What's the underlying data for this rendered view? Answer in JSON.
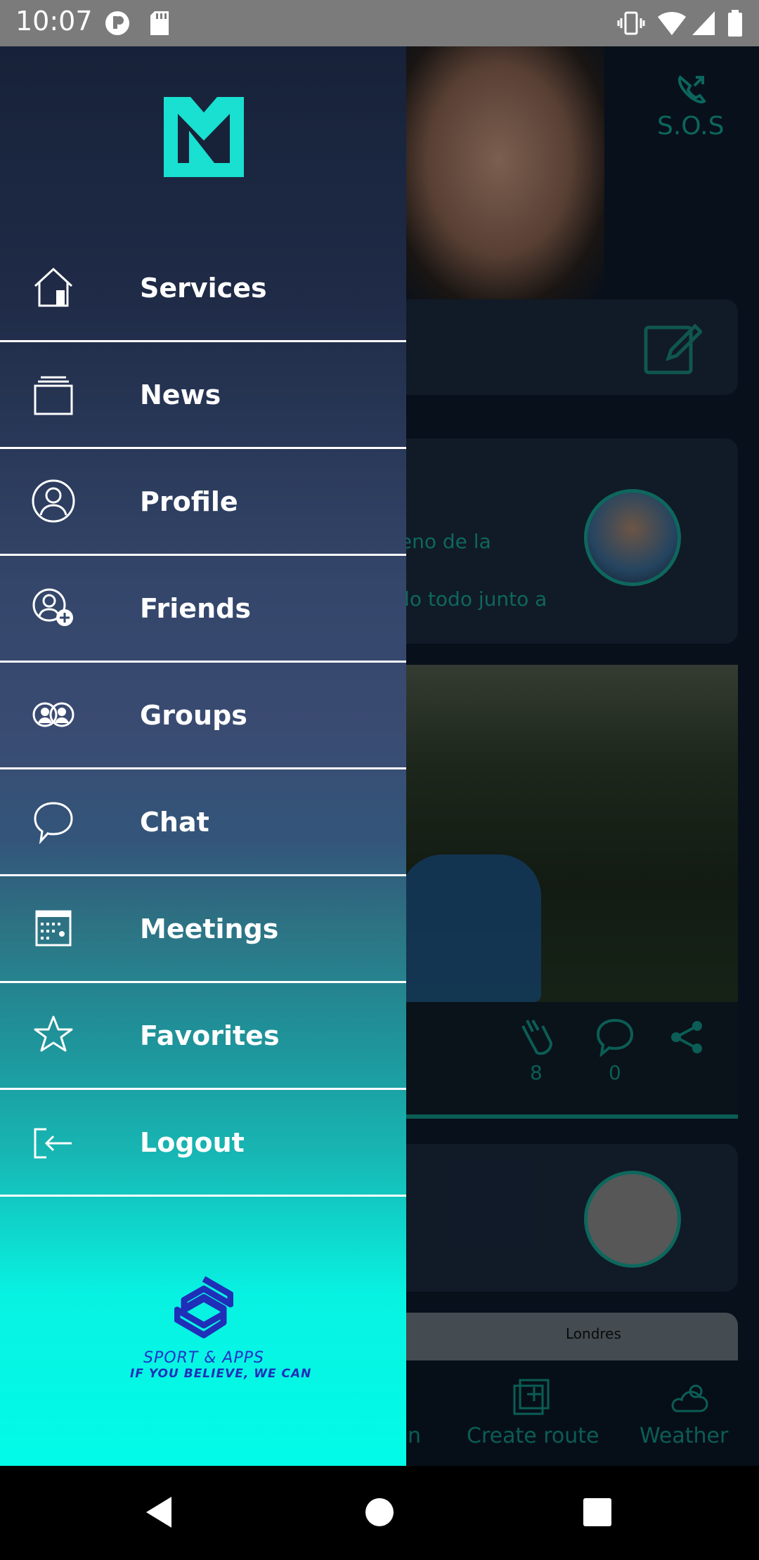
{
  "status_bar": {
    "time": "10:07"
  },
  "background": {
    "sos_label": "S.O.S",
    "post_snippet_1": "reno de la",
    "post_snippet_2": "olo todo junto a",
    "claps_count": "8",
    "comments_count": "0",
    "map_label": "Londres",
    "nav_partial": "n",
    "nav_create_route": "Create route",
    "nav_weather": "Weather"
  },
  "drawer": {
    "items": [
      {
        "label": "Services",
        "icon": "home-icon"
      },
      {
        "label": "News",
        "icon": "stack-icon"
      },
      {
        "label": "Profile",
        "icon": "profile-icon"
      },
      {
        "label": "Friends",
        "icon": "add-friend-icon"
      },
      {
        "label": "Groups",
        "icon": "groups-icon"
      },
      {
        "label": "Chat",
        "icon": "chat-icon"
      },
      {
        "label": "Meetings",
        "icon": "calendar-icon"
      },
      {
        "label": "Favorites",
        "icon": "star-icon"
      },
      {
        "label": "Logout",
        "icon": "logout-icon"
      }
    ],
    "brand_name": "SPORT & APPS",
    "brand_tagline": "IF YOU BELIEVE, WE CAN"
  },
  "colors": {
    "accent": "#17a697",
    "drawer_top": "#172239",
    "drawer_bottom": "#02fbe8",
    "brand_blue": "#2233c8"
  }
}
